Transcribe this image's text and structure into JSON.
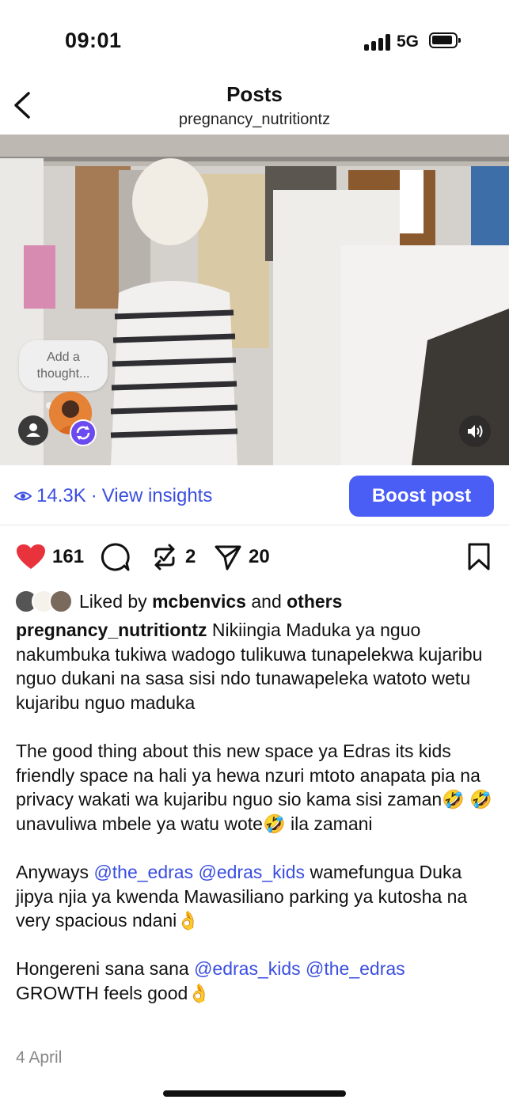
{
  "status_bar": {
    "time": "09:01",
    "network": "5G"
  },
  "header": {
    "title": "Posts",
    "subtitle": "pregnancy_nutritiontz"
  },
  "media": {
    "thought_bubble_line1": "Add a",
    "thought_bubble_line2": "thought..."
  },
  "insights": {
    "views": "14.3K",
    "separator": "·",
    "view_insights_label": "View insights",
    "boost_label": "Boost post"
  },
  "actions": {
    "likes": "161",
    "reposts": "2",
    "shares": "20"
  },
  "liked_by": {
    "prefix": "Liked by",
    "user": "mcbenvics",
    "connector": "and",
    "others": "others"
  },
  "caption": {
    "author": "pregnancy_nutritiontz",
    "p1": "Nikiingia Maduka ya nguo nakumbuka tukiwa wadogo tulikuwa tunapelekwa kujaribu nguo dukani na sasa sisi ndo tunawapeleka watoto wetu kujaribu nguo maduka",
    "p2_a": "The good thing about this new space ya Edras its kids friendly space na hali ya hewa nzuri mtoto anapata pia na privacy wakati wa kujaribu nguo sio kama sisi zaman",
    "p2_emoji1": "🤣 🤣",
    "p2_b": "unavuliwa mbele ya watu wote",
    "p2_emoji2": "🤣",
    "p2_c": " ila zamani",
    "p3_a": "Anyways ",
    "p3_mention1": "@the_edras",
    "p3_mention2": "@edras_kids",
    "p3_b": " wamefungua Duka jipya njia ya kwenda Mawasiliano parking ya kutosha na very spacious ndani",
    "p3_emoji": "👌",
    "p4_a": "Hongereni sana sana ",
    "p4_mention1": "@edras_kids",
    "p4_mention2": "@the_edras",
    "p4_b": "GROWTH feels good",
    "p4_emoji": "👌"
  },
  "date": "4 April",
  "colors": {
    "accent": "#4a5ef5",
    "link": "#3a4ee0",
    "like": "#e8323c"
  }
}
